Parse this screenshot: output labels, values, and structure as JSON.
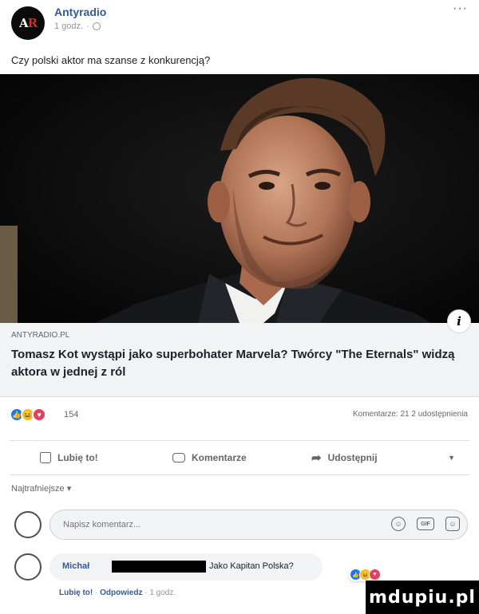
{
  "post": {
    "page_name": "Antyradio",
    "avatar_logo_a": "A",
    "avatar_logo_r": "R",
    "time": "1 godz.",
    "separator": "·",
    "more": "···",
    "text": "Czy polski aktor ma szanse z konkurencją?"
  },
  "link": {
    "domain": "ANTYRADIO.PL",
    "title": "Tomasz Kot wystąpi jako superbohater Marvela? Twórcy \"The Eternals\" widzą aktora w jednej z ról",
    "info": "i"
  },
  "stats": {
    "reaction_count": "154",
    "comments_shares": "Komentarze: 21   2 udostępnienia"
  },
  "actions": {
    "like": "Lubię to!",
    "comment": "Komentarze",
    "share": "Udostępnij",
    "dropdown": "▼"
  },
  "sort": {
    "label": "Najtrafniejsze ▾"
  },
  "comment_input": {
    "placeholder": "Napisz komentarz..."
  },
  "comment": {
    "author": "Michał",
    "text": "Jako Kapitan Polska?",
    "like_link": "Lubię to!",
    "reply_link": "Odpowiedz",
    "time": "1 godz."
  },
  "watermark": {
    "text": "mdupiu.pl"
  },
  "colors": {
    "link_blue": "#365899",
    "like_blue": "#1877f2",
    "haha_yellow": "#f7b928",
    "love_red": "#e4405f",
    "preview_bg": "#f2f3f5"
  }
}
